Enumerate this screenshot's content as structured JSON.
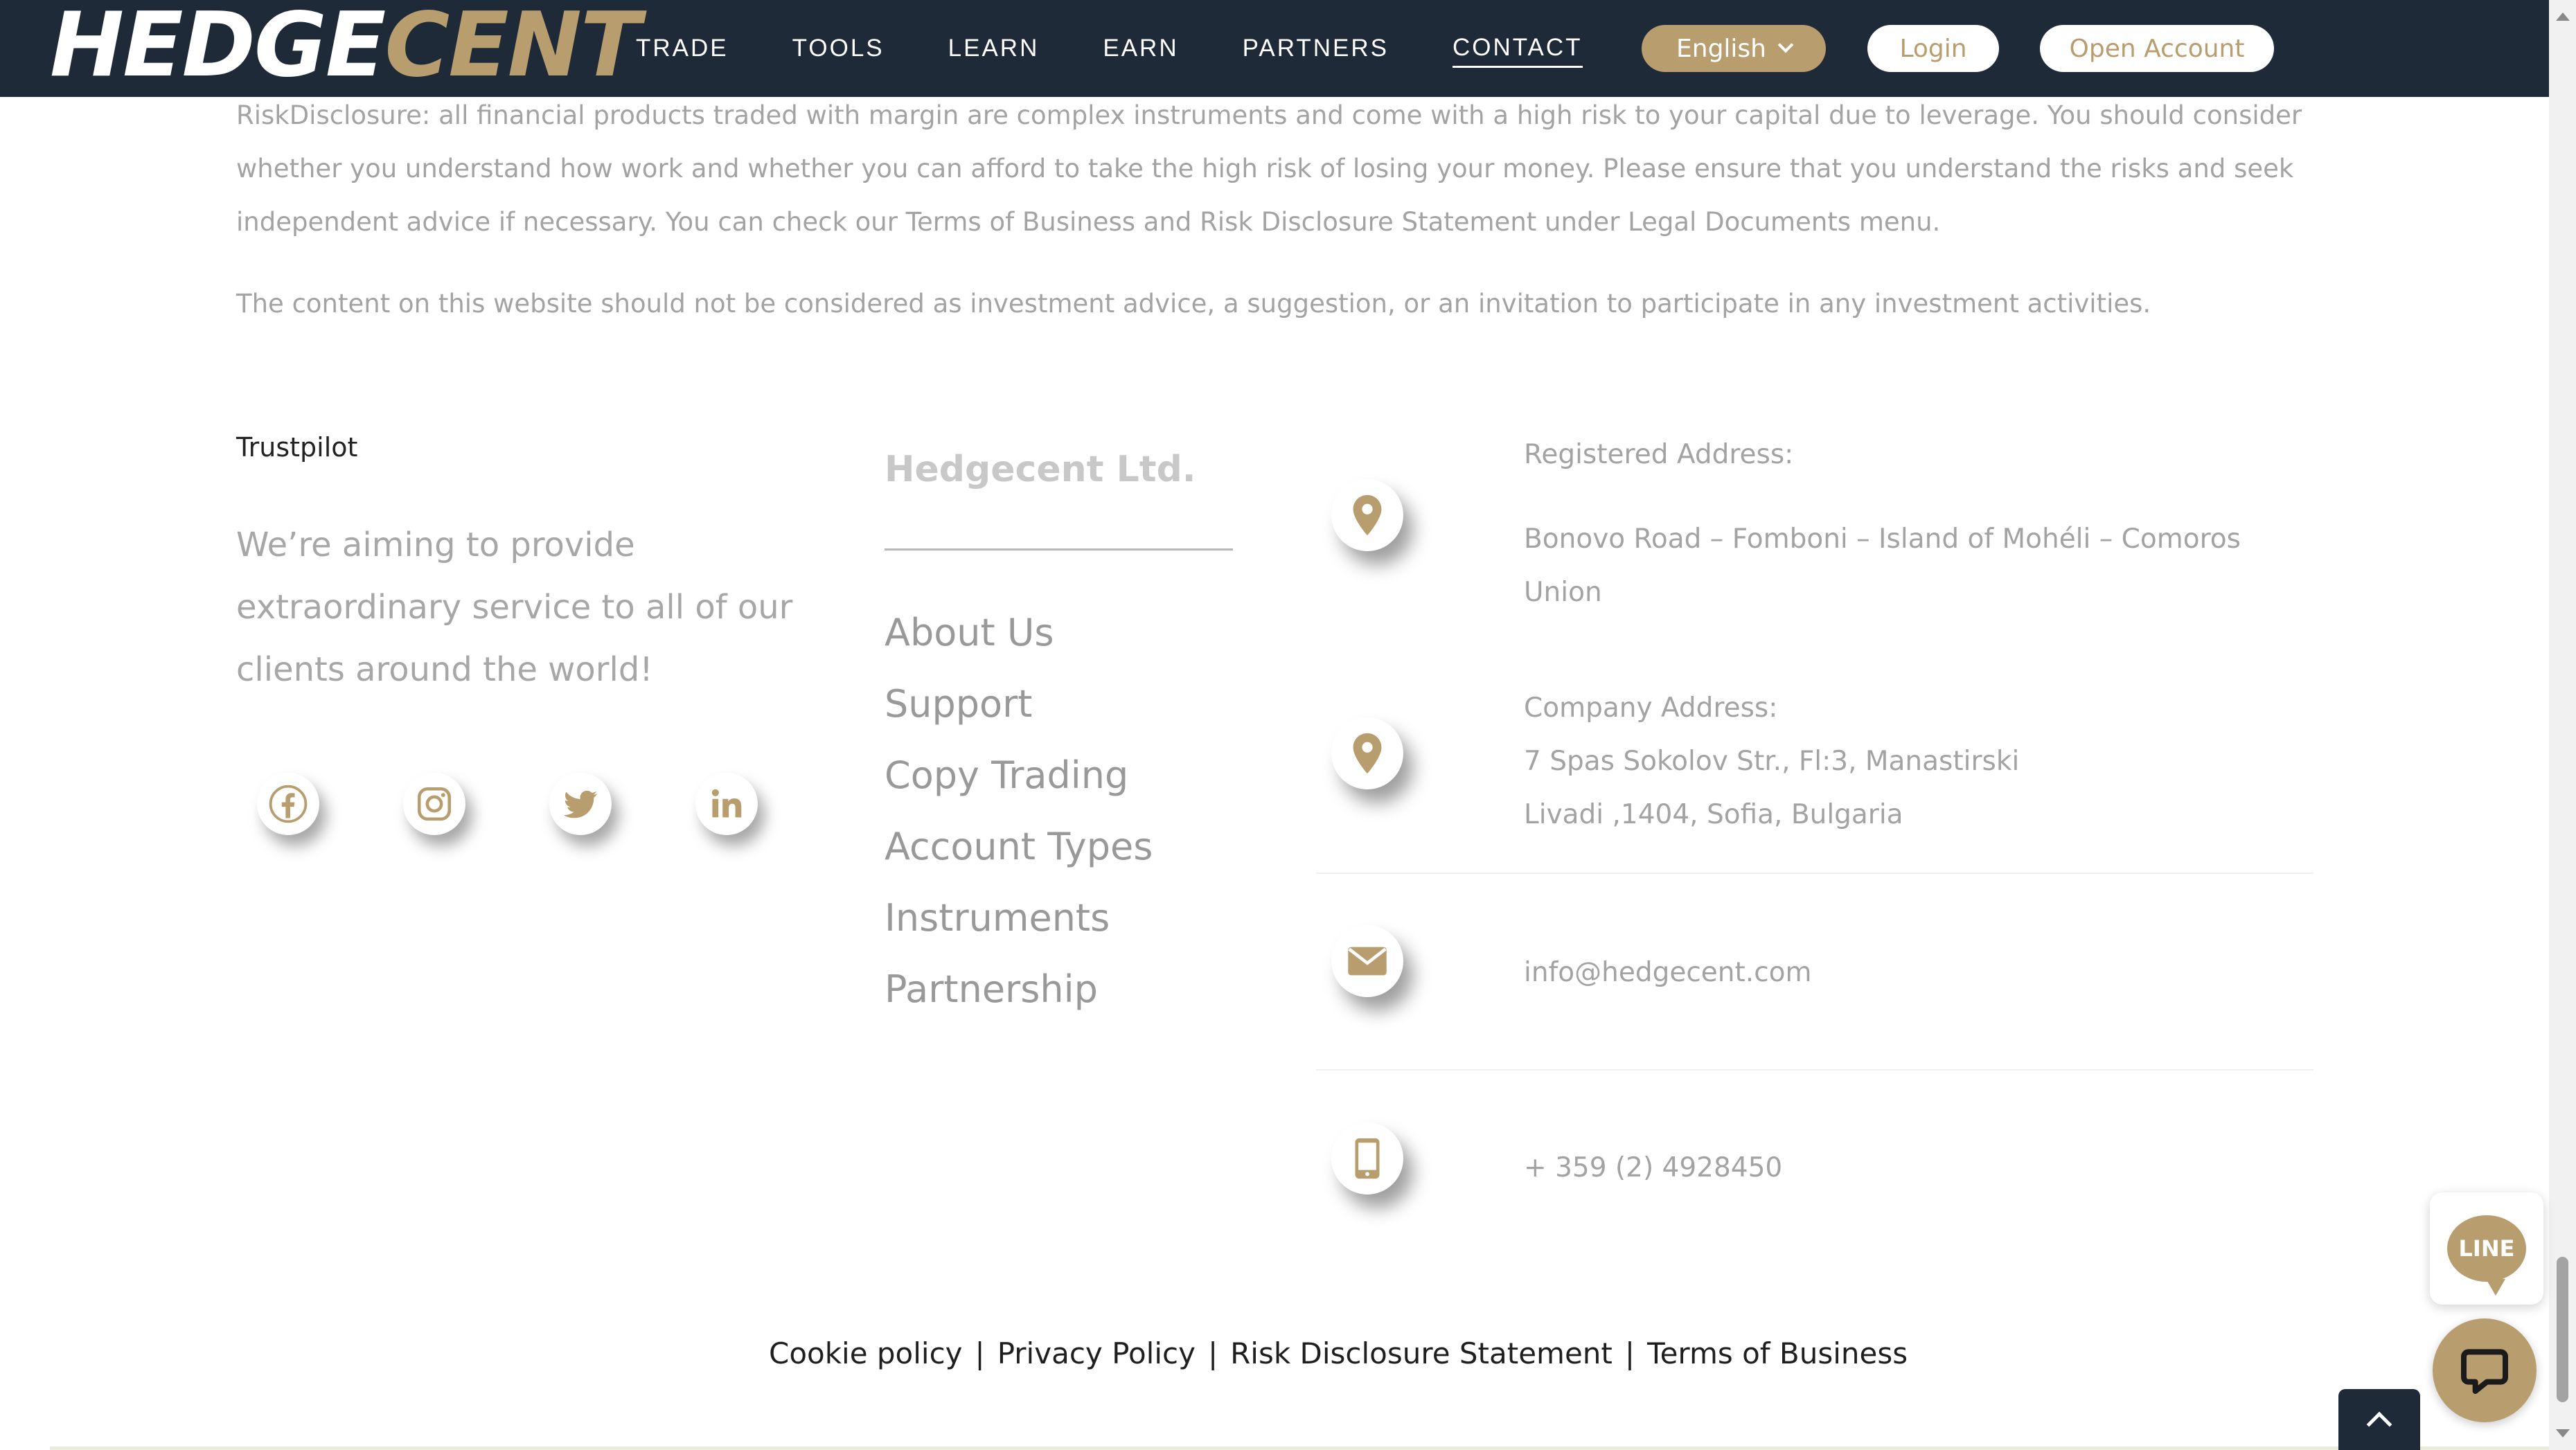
{
  "header": {
    "logo_part1": "HEDGE",
    "logo_part2": "CENT",
    "nav": [
      "TRADE",
      "TOOLS",
      "LEARN",
      "EARN",
      "PARTNERS",
      "CONTACT"
    ],
    "active_nav": "CONTACT",
    "language": "English",
    "login_label": "Login",
    "open_account_label": "Open Account"
  },
  "disclaimer": {
    "risk": "RiskDisclosure: all financial products traded with margin are complex instruments and come with a high risk to your capital due to leverage. You should consider whether you understand how work and whether you can afford to take the high risk of losing your money. Please ensure that you understand the risks and seek independent advice if necessary. You can check our Terms of Business and Risk Disclosure Statement under Legal Documents menu.",
    "advice": "The content on this website should not be considered as investment advice, a suggestion, or an invitation to participate in any investment activities."
  },
  "about": {
    "trustpilot": "Trustpilot",
    "tagline": "We’re aiming to provide extraordinary service to all of our clients around the world!",
    "socials": [
      "facebook-icon",
      "instagram-icon",
      "twitter-icon",
      "linkedin-icon"
    ]
  },
  "company": {
    "title": "Hedgecent Ltd.",
    "links": [
      "About Us",
      "Support",
      "Copy Trading",
      "Account Types",
      "Instruments",
      "Partnership"
    ]
  },
  "contact": {
    "registered_label": "Registered Address:",
    "registered_address": "Bonovo Road – Fomboni – Island of Mohéli – Comoros Union",
    "company_label": "Company Address:",
    "company_address_line1": "7 Spas Sokolov Str., Fl:3, Manastirski",
    "company_address_line2": "Livadi ,1404, Sofia, Bulgaria",
    "email": "info@hedgecent.com",
    "phone": "+ 359 (2) 4928450"
  },
  "footer_links": [
    "Cookie policy",
    "Privacy Policy",
    "Risk Disclosure Statement",
    "Terms of Business"
  ],
  "footer_separator": "|",
  "widgets": {
    "line_label": "LINE"
  },
  "colors": {
    "header_bg": "#1e2a38",
    "accent_gold": "#b89d6e",
    "text_muted": "#a3a3a3"
  }
}
